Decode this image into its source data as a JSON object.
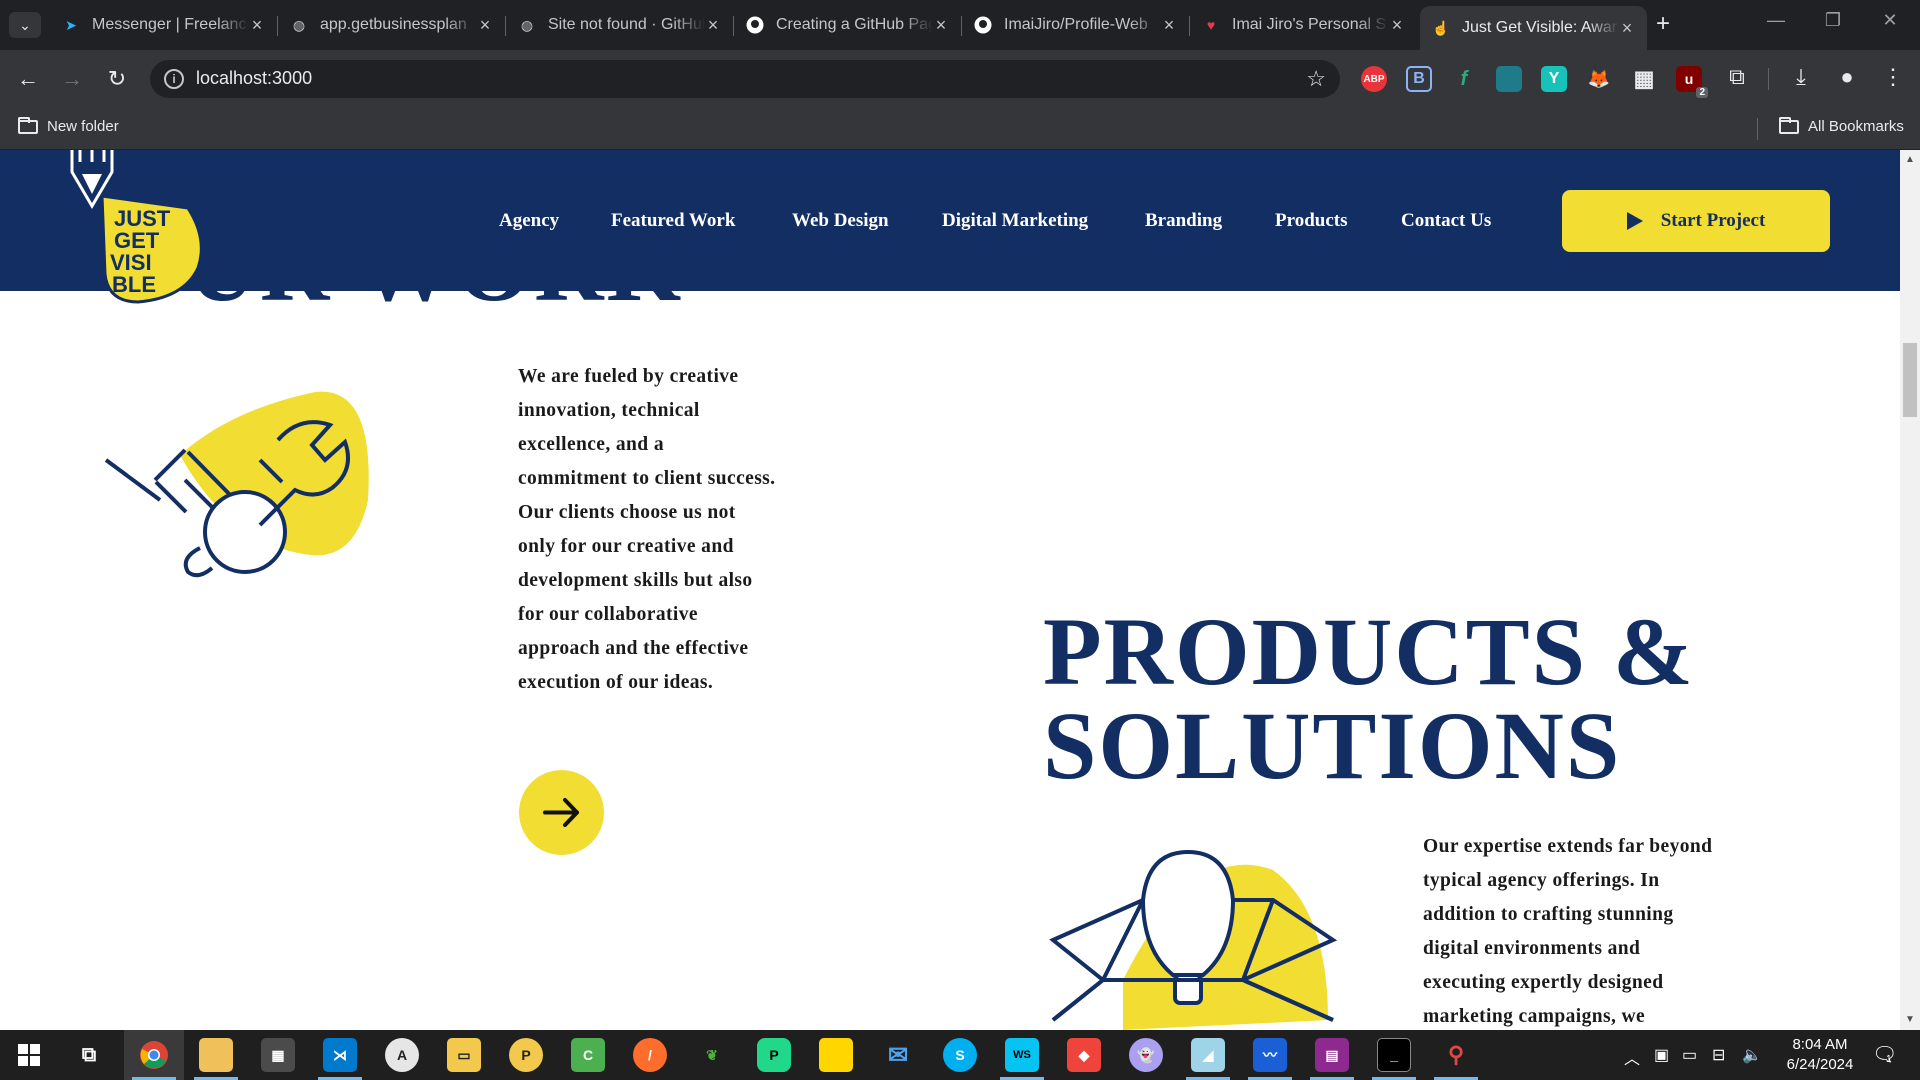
{
  "browser": {
    "tabs": [
      {
        "label": "Messenger | Freelancer",
        "icon": "freelancer-icon",
        "color": "#29b2fe"
      },
      {
        "label": "app.getbusinessplan",
        "icon": "globe-icon",
        "color": "#c4c7c5"
      },
      {
        "label": "Site not found · GitHub",
        "icon": "globe-icon",
        "color": "#c4c7c5"
      },
      {
        "label": "Creating a GitHub Page",
        "icon": "github-icon",
        "color": "#ffffff"
      },
      {
        "label": "ImaiJiro/Profile-Web",
        "icon": "github-icon",
        "color": "#ffffff"
      },
      {
        "label": "Imai Jiro's Personal S",
        "icon": "heart-icon",
        "color": "#e53950"
      },
      {
        "label": "Just Get Visible: Award",
        "icon": "pointer-icon",
        "color": "#f2dd33"
      }
    ],
    "url": "localhost:3000",
    "bookmarks": {
      "folder": "New folder",
      "all": "All Bookmarks"
    },
    "extensions": [
      {
        "name": "adblock-plus-icon",
        "label": "ABP",
        "color": "#e8343a"
      },
      {
        "name": "b-extension-icon",
        "label": "B",
        "color": "#8ab4f8"
      },
      {
        "name": "feather-extension-icon",
        "label": "f",
        "color": "#2a7f62"
      },
      {
        "name": "square-extension-icon",
        "label": "",
        "color": "#1f7a8c"
      },
      {
        "name": "y-extension-icon",
        "label": "Y",
        "color": "#17c2b9"
      },
      {
        "name": "metamask-icon",
        "label": "🦊",
        "color": "#35363a"
      },
      {
        "name": "qr-extension-icon",
        "label": "▦",
        "color": "#35363a"
      },
      {
        "name": "ublock-icon",
        "label": "u",
        "color": "#800000"
      }
    ],
    "ublock_badge": "2"
  },
  "site": {
    "logo_text": [
      "JUST",
      "GET",
      "VISI",
      "BLE"
    ],
    "nav": [
      "Agency",
      "Featured Work",
      "Web Design",
      "Digital Marketing",
      "Branding",
      "Products",
      "Contact Us"
    ],
    "cta": "Start Project",
    "work_heading": "OUR WORK",
    "work_body": "We are fueled by creative innovation, technical excellence, and a commitment to client success. Our clients choose us not only for our creative and development skills but also for our collaborative approach and the effective execution of our ideas.",
    "products_heading_line1": "PRODUCTS &",
    "products_heading_line2": "SOLUTIONS",
    "products_body": "Our expertise extends far beyond typical agency offerings. In addition to crafting stunning digital environments and executing expertly designed marketing campaigns, we",
    "colors": {
      "navy": "#122e63",
      "yellow": "#f2dd33"
    }
  },
  "taskbar": {
    "apps": [
      "windows-start-icon",
      "task-view-icon",
      "chrome-icon",
      "file-explorer-icon",
      "store-icon",
      "vscode-icon",
      "app-a-icon",
      "folder-app-icon",
      "postman-icon",
      "camtasia-icon",
      "sublime-icon",
      "mongodb-icon",
      "pycharm-icon",
      "sticky-notes-icon",
      "mail-icon",
      "skype-icon",
      "webstorm-icon",
      "anydesk-icon",
      "phantom-icon",
      "tool-icon",
      "whiteboard-icon",
      "winrar-icon",
      "terminal-icon",
      "mongodb-compass-icon"
    ],
    "time": "8:04 AM",
    "date": "6/24/2024",
    "notifications": "1"
  }
}
